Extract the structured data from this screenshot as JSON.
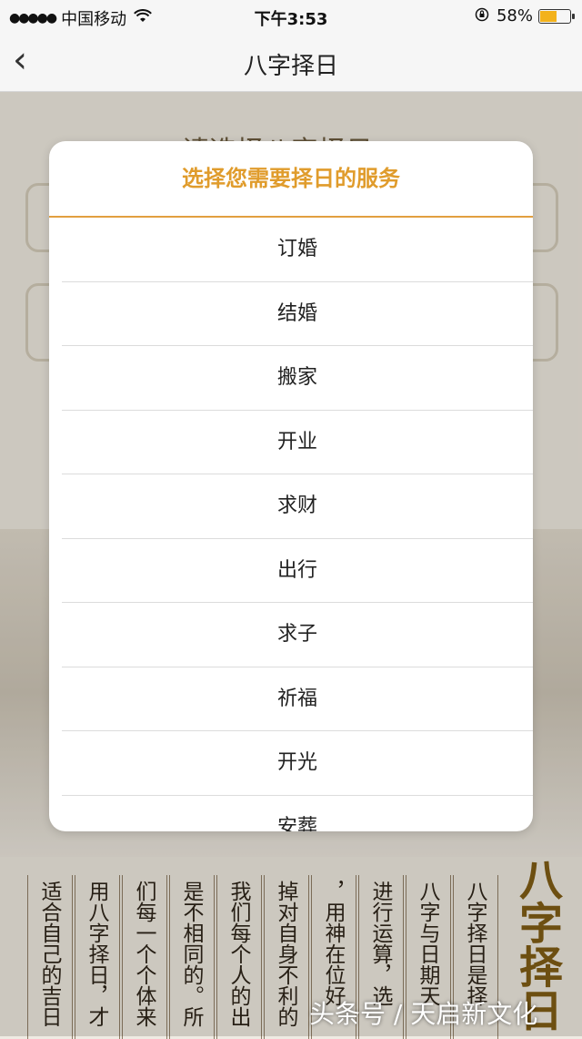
{
  "status_bar": {
    "signal_dots": "●●●●●",
    "carrier": "中国移动",
    "wifi_icon": "wifi-icon",
    "time": "下午3:53",
    "battery_percent": "58%",
    "battery_level": 0.58,
    "battery_color": "#f3b21b"
  },
  "nav": {
    "back_icon": "‹",
    "title": "八字择日"
  },
  "background": {
    "heading": "请选择八字择日",
    "columns": [
      "适合自己的吉日",
      "用八字择日，才",
      "们每一个个体来",
      "是不相同的。所",
      "我们每个人的出",
      "掉对自身不利的",
      "，用神在位好",
      "进行运算，选",
      "八字与日期天",
      "八字择日是择"
    ],
    "big_title": "八字择日"
  },
  "modal": {
    "title": "选择您需要择日的服务",
    "accent_color": "#e09c2c",
    "options": [
      "订婚",
      "结婚",
      "搬家",
      "开业",
      "求财",
      "出行",
      "求子",
      "祈福",
      "开光",
      "安葬"
    ]
  },
  "watermark": "头条号 / 天启新文化"
}
